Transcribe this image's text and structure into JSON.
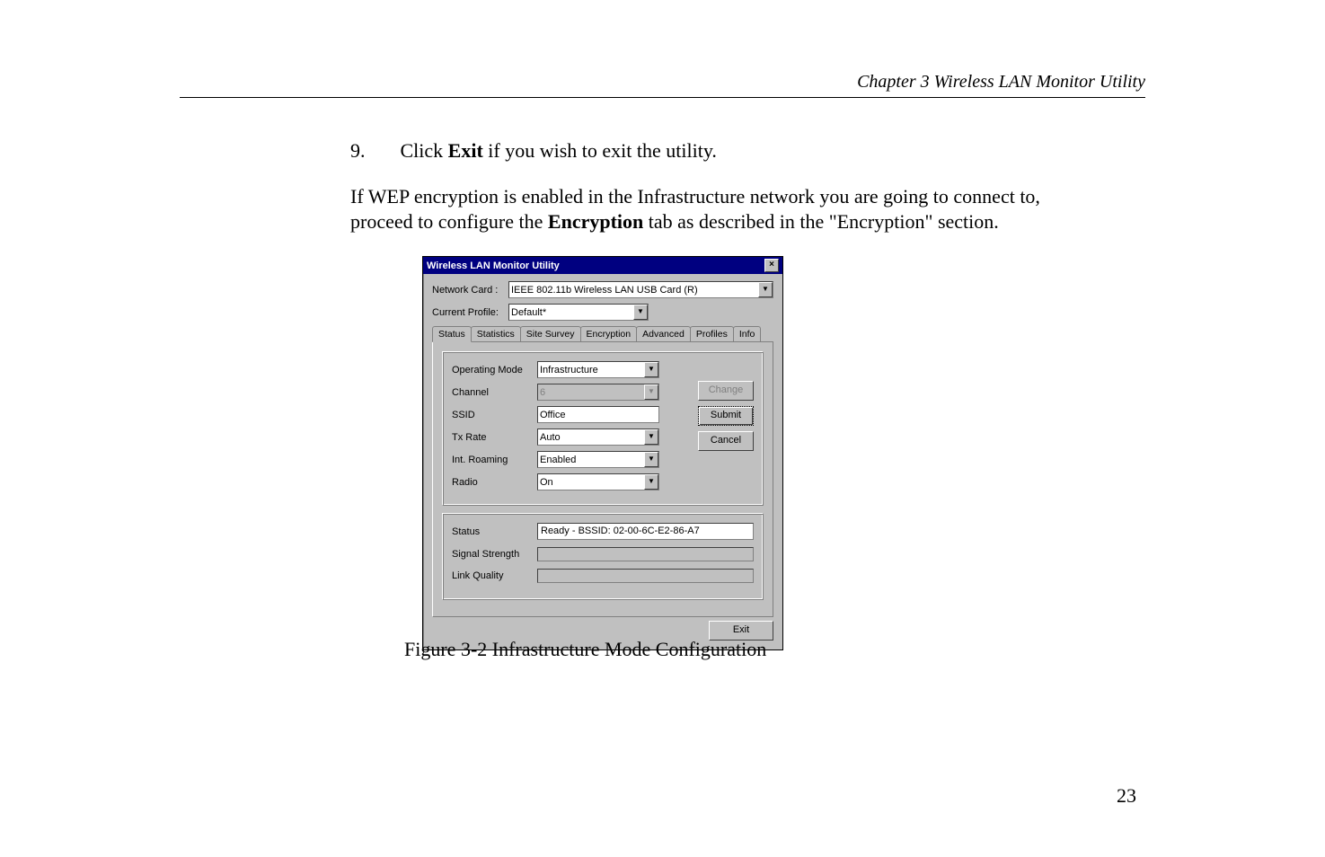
{
  "header": {
    "chapter": "Chapter 3    Wireless LAN Monitor Utility"
  },
  "step": {
    "number": "9.",
    "prefix": "Click ",
    "bold": "Exit",
    "suffix": " if you wish to exit the utility."
  },
  "paragraph": {
    "line1a": "If WEP encryption is enabled in the Infrastructure network you are going to connect to,",
    "line2a": "proceed to configure the ",
    "line2b": "Encryption",
    "line2c": " tab as described in the \"Encryption\" section."
  },
  "dialog": {
    "title": "Wireless LAN Monitor Utility",
    "close_glyph": "×",
    "network_card_label": "Network Card :",
    "network_card_value": "IEEE 802.11b Wireless LAN USB Card (R)",
    "current_profile_label": "Current Profile:",
    "current_profile_value": "Default*",
    "tabs": {
      "status": "Status",
      "statistics": "Statistics",
      "site_survey": "Site Survey",
      "encryption": "Encryption",
      "advanced": "Advanced",
      "profiles": "Profiles",
      "info": "Info"
    },
    "fields": {
      "operating_mode_label": "Operating Mode",
      "operating_mode_value": "Infrastructure",
      "channel_label": "Channel",
      "channel_value": "6",
      "ssid_label": "SSID",
      "ssid_value": "Office",
      "txrate_label": "Tx Rate",
      "txrate_value": "Auto",
      "roaming_label": "Int. Roaming",
      "roaming_value": "Enabled",
      "radio_label": "Radio",
      "radio_value": "On"
    },
    "buttons": {
      "change": "Change",
      "submit": "Submit",
      "cancel": "Cancel",
      "exit": "Exit"
    },
    "status": {
      "status_label": "Status",
      "status_value": "Ready - BSSID: 02-00-6C-E2-86-A7",
      "signal_label": "Signal Strength",
      "link_label": "Link Quality"
    }
  },
  "caption": "Figure 3-2    Infrastructure Mode Configuration",
  "page_number": "23"
}
